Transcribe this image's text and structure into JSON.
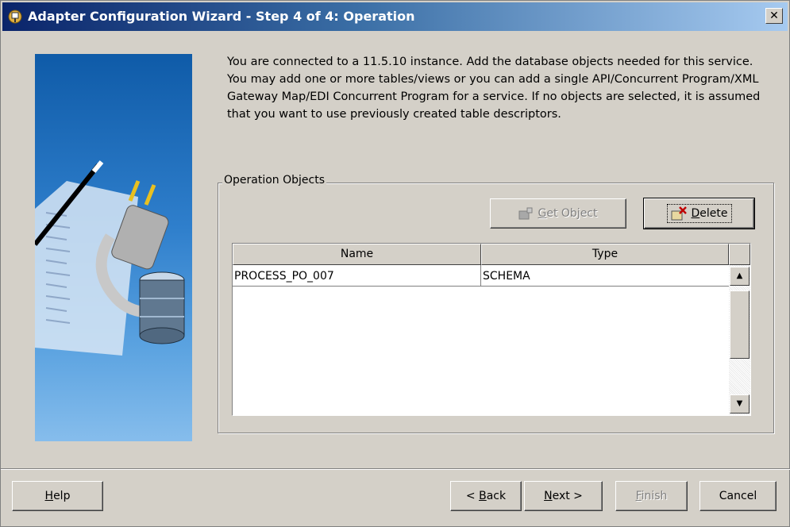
{
  "window": {
    "title": "Adapter Configuration Wizard - Step 4 of 4: Operation",
    "close_glyph": "✕"
  },
  "instructions": "You are connected to a 11.5.10 instance. Add the database objects needed for this service. You may add one or more tables/views or you can add a single API/Concurrent Program/XML Gateway Map/EDI Concurrent Program for a service. If no objects are selected, it is assumed that you want to use previously created table descriptors.",
  "operation_objects": {
    "group_label": "Operation Objects",
    "get_object": {
      "mnemonic": "G",
      "rest": "et Object",
      "enabled": false
    },
    "delete": {
      "mnemonic": "D",
      "rest": "elete",
      "enabled": true
    },
    "columns": {
      "name": "Name",
      "type": "Type"
    },
    "rows": [
      {
        "name": "PROCESS_PO_007",
        "type": "SCHEMA"
      }
    ]
  },
  "footer": {
    "help": {
      "mnemonic": "H",
      "rest": "elp"
    },
    "back": {
      "pre": "< ",
      "mnemonic": "B",
      "rest": "ack"
    },
    "next": {
      "mnemonic": "N",
      "rest": "ext >"
    },
    "finish": {
      "mnemonic": "F",
      "rest": "inish",
      "enabled": false
    },
    "cancel": "Cancel"
  },
  "icons": {
    "title": "adapter-plug-icon",
    "get_object": "add-object-icon",
    "delete": "delete-object-icon"
  },
  "colors": {
    "titlebar_start": "#0a246a",
    "titlebar_end": "#a6caf0",
    "face": "#d4d0c8"
  }
}
